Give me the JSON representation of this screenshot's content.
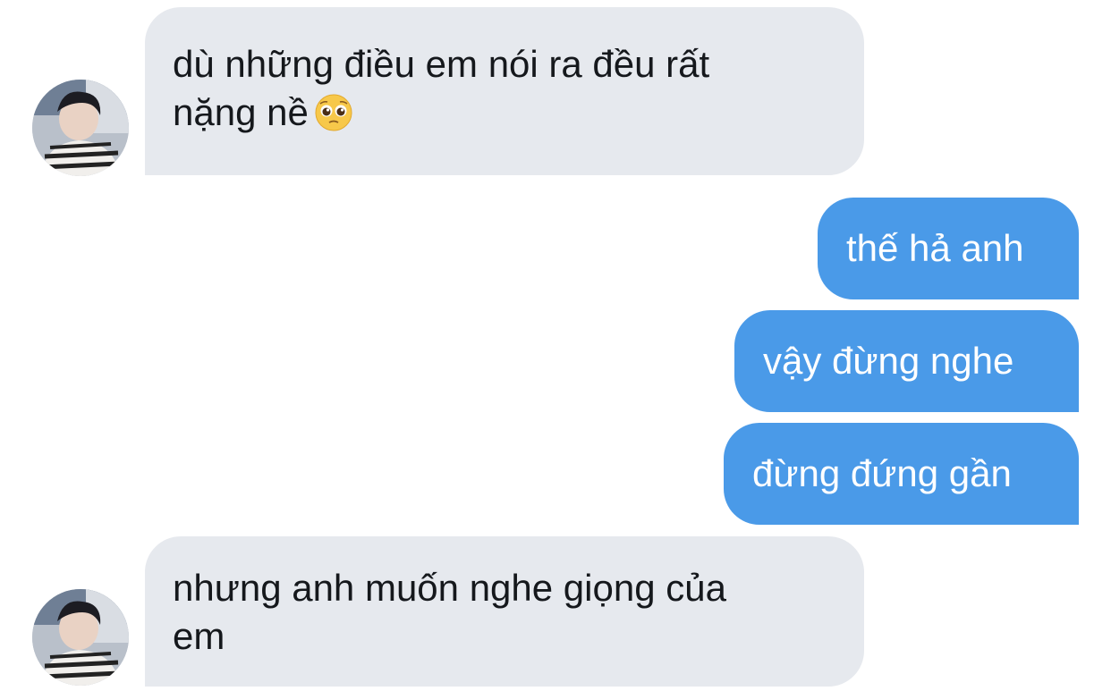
{
  "conversation": {
    "messages": [
      {
        "sender": "other",
        "lines": [
          "dù những điều em nói ra đều rất",
          "nặng nề"
        ],
        "emoji": "pleading-face-emoji"
      },
      {
        "sender": "me",
        "text": "thế hả anh"
      },
      {
        "sender": "me",
        "text": "vậy đừng nghe"
      },
      {
        "sender": "me",
        "text": "đừng đứng gần"
      },
      {
        "sender": "other",
        "lines": [
          "nhưng anh muốn nghe giọng của",
          "em"
        ]
      }
    ]
  },
  "colors": {
    "incoming_bubble": "#e6e9ee",
    "outgoing_bubble": "#4a9ae8",
    "incoming_text": "#15181c",
    "outgoing_text": "#ffffff"
  }
}
